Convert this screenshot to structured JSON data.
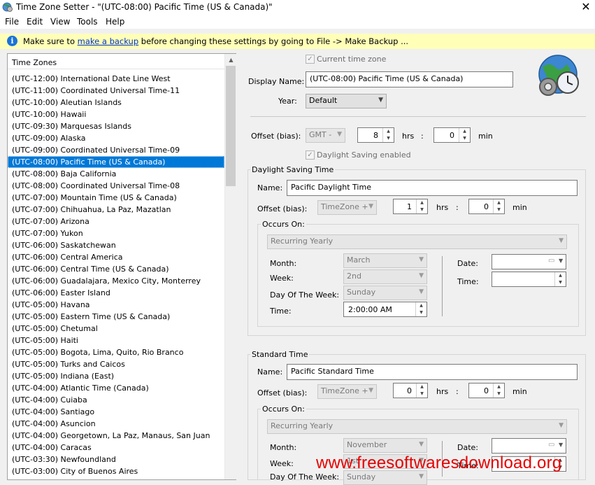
{
  "window": {
    "title": "Time Zone Setter - \"(UTC-08:00) Pacific Time (US & Canada)\""
  },
  "menu": {
    "items": [
      "File",
      "Edit",
      "View",
      "Tools",
      "Help"
    ]
  },
  "info": {
    "text_before": "Make sure to ",
    "link": "make a backup",
    "text_after": " before changing these settings by going to File -> Make Backup ..."
  },
  "list": {
    "header": "Time Zones",
    "selected_index": 7,
    "items": [
      "(UTC-12:00) International Date Line West",
      "(UTC-11:00) Coordinated Universal Time-11",
      "(UTC-10:00) Aleutian Islands",
      "(UTC-10:00) Hawaii",
      "(UTC-09:30) Marquesas Islands",
      "(UTC-09:00) Alaska",
      "(UTC-09:00) Coordinated Universal Time-09",
      "(UTC-08:00) Pacific Time (US & Canada)",
      "(UTC-08:00) Baja California",
      "(UTC-08:00) Coordinated Universal Time-08",
      "(UTC-07:00) Mountain Time (US & Canada)",
      "(UTC-07:00) Chihuahua, La Paz, Mazatlan",
      "(UTC-07:00) Arizona",
      "(UTC-07:00) Yukon",
      "(UTC-06:00) Saskatchewan",
      "(UTC-06:00) Central America",
      "(UTC-06:00) Central Time (US & Canada)",
      "(UTC-06:00) Guadalajara, Mexico City, Monterrey",
      "(UTC-06:00) Easter Island",
      "(UTC-05:00) Havana",
      "(UTC-05:00) Eastern Time (US & Canada)",
      "(UTC-05:00) Chetumal",
      "(UTC-05:00) Haiti",
      "(UTC-05:00) Bogota, Lima, Quito, Rio Branco",
      "(UTC-05:00) Turks and Caicos",
      "(UTC-05:00) Indiana (East)",
      "(UTC-04:00) Atlantic Time (Canada)",
      "(UTC-04:00) Cuiaba",
      "(UTC-04:00) Santiago",
      "(UTC-04:00) Asuncion",
      "(UTC-04:00) Georgetown, La Paz, Manaus, San Juan",
      "(UTC-04:00) Caracas",
      "(UTC-03:30) Newfoundland",
      "(UTC-03:00) City of Buenos Aires"
    ]
  },
  "details": {
    "current_tz_label": "Current time zone",
    "display_name_label": "Display Name:",
    "display_name_value": "(UTC-08:00) Pacific Time (US & Canada)",
    "year_label": "Year:",
    "year_value": "Default",
    "offset_label": "Offset (bias):",
    "offset_sign": "GMT -",
    "offset_hrs": "8",
    "offset_min": "0",
    "hrs_label": "hrs",
    "colon": ":",
    "min_label": "min",
    "dst_enabled_label": "Daylight Saving enabled"
  },
  "dst": {
    "group_title": "Daylight Saving Time",
    "name_label": "Name:",
    "name_value": "Pacific Daylight Time",
    "offset_label": "Offset (bias):",
    "offset_mode": "TimeZone +",
    "hrs": "1",
    "min": "0",
    "occurs_title": "Occurs On:",
    "recurrence": "Recurring Yearly",
    "month_label": "Month:",
    "month_value": "March",
    "week_label": "Week:",
    "week_value": "2nd",
    "dow_label": "Day Of The Week:",
    "dow_value": "Sunday",
    "time_label": "Time:",
    "time_value": "2:00:00 AM",
    "date_label": "Date:",
    "time2_label": "Time:"
  },
  "std": {
    "group_title": "Standard Time",
    "name_label": "Name:",
    "name_value": "Pacific Standard Time",
    "offset_label": "Offset (bias):",
    "offset_mode": "TimeZone +",
    "hrs": "0",
    "min": "0",
    "occurs_title": "Occurs On:",
    "recurrence": "Recurring Yearly",
    "month_label": "Month:",
    "month_value": "November",
    "week_label": "Week:",
    "week_value": "1st",
    "dow_label": "Day Of The Week:",
    "dow_value": "Sunday",
    "date_label": "Date:",
    "time2_label": "Time:"
  },
  "watermark": "www.freesoftwaresdownload.org",
  "colors": {
    "selection": "#0078d7",
    "infobar": "#ffffb8",
    "link": "#0033cc",
    "watermark": "#e60000"
  }
}
